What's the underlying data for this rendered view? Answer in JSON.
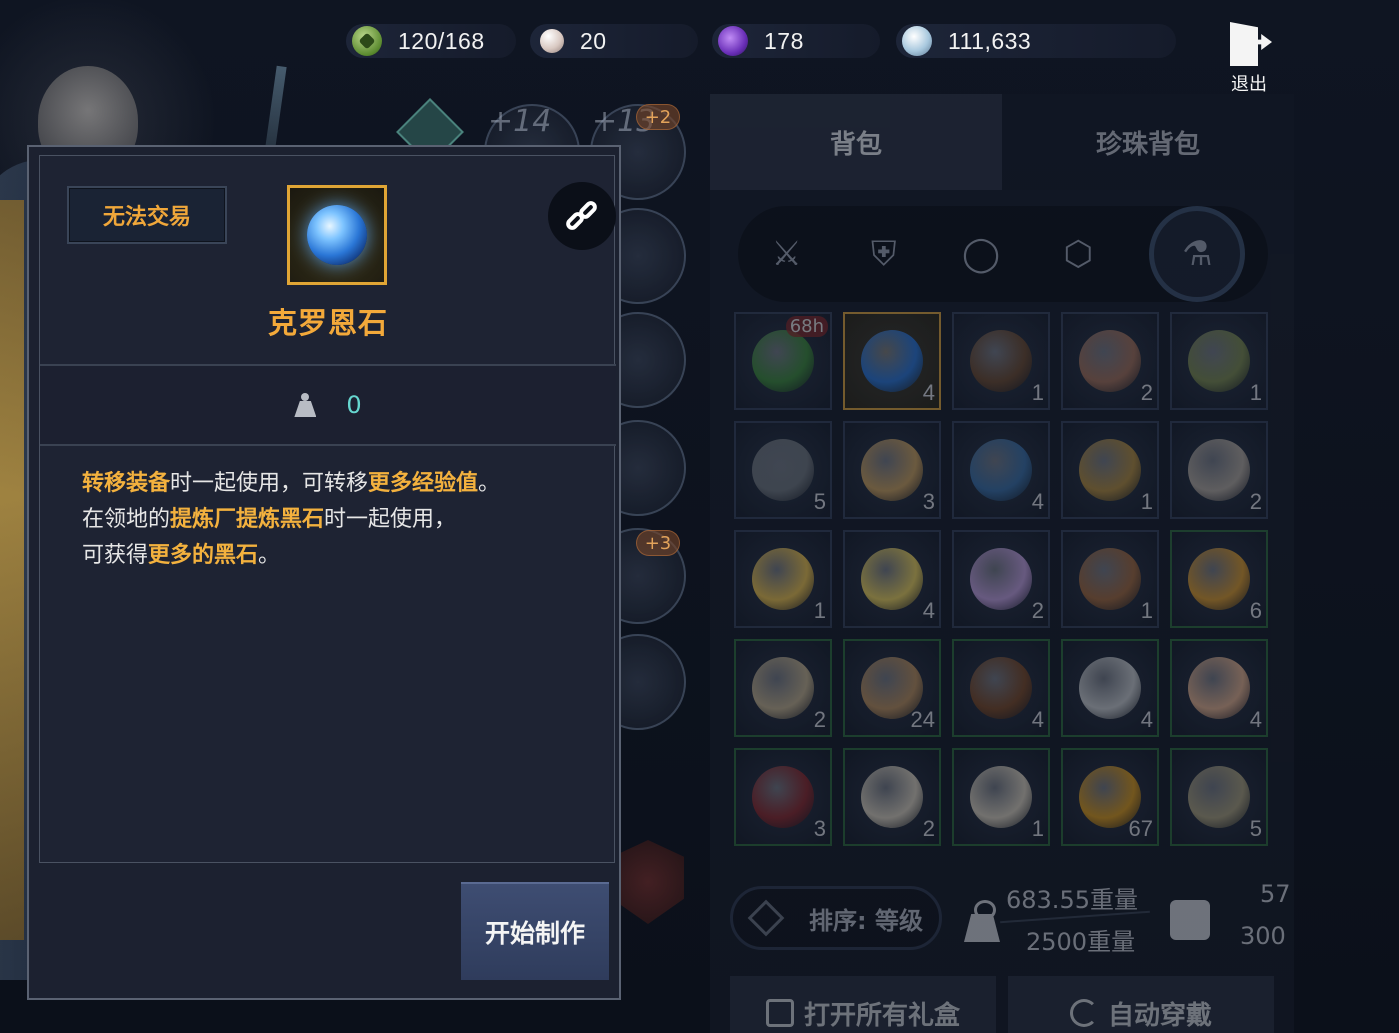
{
  "resources": [
    {
      "icon": "energy-icon",
      "value": "120/168"
    },
    {
      "icon": "pearl-icon",
      "value": "20"
    },
    {
      "icon": "crystal-icon",
      "value": "178"
    },
    {
      "icon": "silver-icon",
      "value": "111,633"
    }
  ],
  "exit": {
    "label": "退出",
    "icon": "exit-door-icon"
  },
  "equipment": {
    "levels": [
      "+14",
      "+13",
      "+2"
    ],
    "badge": "+3"
  },
  "inventory": {
    "tabs": [
      {
        "label": "背包",
        "active": true
      },
      {
        "label": "珍珠背包",
        "active": false
      }
    ],
    "filters": [
      {
        "icon": "swords-icon",
        "glyph": "⚔"
      },
      {
        "icon": "armor-icon",
        "glyph": "⛨"
      },
      {
        "icon": "ring-icon",
        "glyph": "◯"
      },
      {
        "icon": "gem-icon",
        "glyph": "⬡"
      },
      {
        "icon": "potion-icon",
        "glyph": "⚗",
        "active": true
      }
    ],
    "items": [
      {
        "qty": "",
        "timer": "68h",
        "color": "#3d8a3c",
        "border": "normal"
      },
      {
        "qty": "4",
        "color": "#2a76d6",
        "border": "gold"
      },
      {
        "qty": "1",
        "color": "#6b4a30",
        "border": "normal"
      },
      {
        "qty": "2",
        "color": "#a0705a",
        "border": "normal"
      },
      {
        "qty": "1",
        "color": "#7a8a50",
        "border": "normal"
      },
      {
        "qty": "5",
        "color": "#707880",
        "border": "normal"
      },
      {
        "qty": "3",
        "color": "#c8a060",
        "border": "normal"
      },
      {
        "qty": "4",
        "color": "#3a70a8",
        "border": "normal"
      },
      {
        "qty": "1",
        "color": "#b08c40",
        "border": "normal"
      },
      {
        "qty": "2",
        "color": "#b0a8a0",
        "border": "normal"
      },
      {
        "qty": "1",
        "color": "#e8c050",
        "border": "normal"
      },
      {
        "qty": "4",
        "color": "#e8d060",
        "border": "normal"
      },
      {
        "qty": "2",
        "color": "#c0a0e0",
        "border": "normal"
      },
      {
        "qty": "1",
        "color": "#a06a40",
        "border": "normal"
      },
      {
        "qty": "6",
        "color": "#d89a30",
        "border": "green"
      },
      {
        "qty": "2",
        "color": "#c0b090",
        "border": "green"
      },
      {
        "qty": "24",
        "color": "#b89060",
        "border": "green"
      },
      {
        "qty": "4",
        "color": "#7a4a2a",
        "border": "green"
      },
      {
        "qty": "4",
        "color": "#c8ccd0",
        "border": "green"
      },
      {
        "qty": "4",
        "color": "#e0b090",
        "border": "green"
      },
      {
        "qty": "3",
        "color": "#8a2a30",
        "border": "green"
      },
      {
        "qty": "2",
        "color": "#d8d0c0",
        "border": "green"
      },
      {
        "qty": "1",
        "color": "#d8d0c0",
        "border": "green"
      },
      {
        "qty": "67",
        "color": "#d89a20",
        "border": "green"
      },
      {
        "qty": "5",
        "color": "#a8a080",
        "border": "green"
      }
    ],
    "sort_label": "排序: 等级",
    "weight_current": "683.55重量",
    "weight_max": "2500重量",
    "slots_current": "57",
    "slots_max": "300",
    "open_all_label": "打开所有礼盒",
    "auto_equip_label": "自动穿戴"
  },
  "item_detail": {
    "trade_badge": "无法交易",
    "name": "克罗恩石",
    "weight_value": "0",
    "desc_line1": [
      {
        "text": "转移装备",
        "hl": true
      },
      {
        "text": "时一起使用，可转移",
        "hl": false
      },
      {
        "text": "更多经验值",
        "hl": true
      },
      {
        "text": "。",
        "hl": false
      }
    ],
    "desc_line2": [
      {
        "text": "在领地的",
        "hl": false
      },
      {
        "text": "提炼厂提炼黑石",
        "hl": true
      },
      {
        "text": "时一起使用，",
        "hl": false
      }
    ],
    "desc_line3": [
      {
        "text": "可获得",
        "hl": false
      },
      {
        "text": "更多的黑石",
        "hl": true
      },
      {
        "text": "。",
        "hl": false
      }
    ],
    "craft_button": "开始制作"
  },
  "colors": {
    "accent_gold": "#f3a93a",
    "weight_teal": "#66d6cf"
  }
}
